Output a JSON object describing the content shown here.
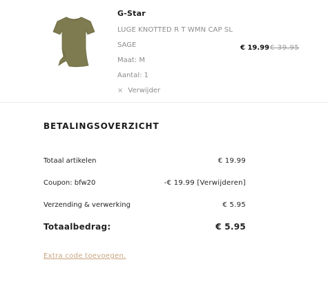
{
  "product": {
    "brand": "G-Star",
    "name": "LUGE KNOTTED R T WMN CAP SL",
    "color": "SAGE",
    "size": "Maat: M",
    "quantity": "Aantal: 1",
    "remove_icon": "×",
    "remove_label": "Verwijder",
    "price": "€ 19.99",
    "price_original": "€ 39.95",
    "image_icon": "tshirt-image",
    "shirt_color": "#7d7b4f"
  },
  "summary": {
    "title": "BETALINGSOVERZICHT",
    "rows": [
      {
        "label": "Totaal artikelen",
        "value": "€ 19.99"
      },
      {
        "label": "Coupon: bfw20",
        "value": "-€ 19.99 [Verwijderen]"
      },
      {
        "label": "Verzending & verwerking",
        "value": "€ 5.95"
      }
    ],
    "total": {
      "label": "Totaalbedrag:",
      "value": "€ 5.95"
    },
    "extra_code_link": "Extra code toevoegen."
  },
  "colors": {
    "accent_link": "#c8a57f",
    "muted_text": "#8c8c8c"
  }
}
